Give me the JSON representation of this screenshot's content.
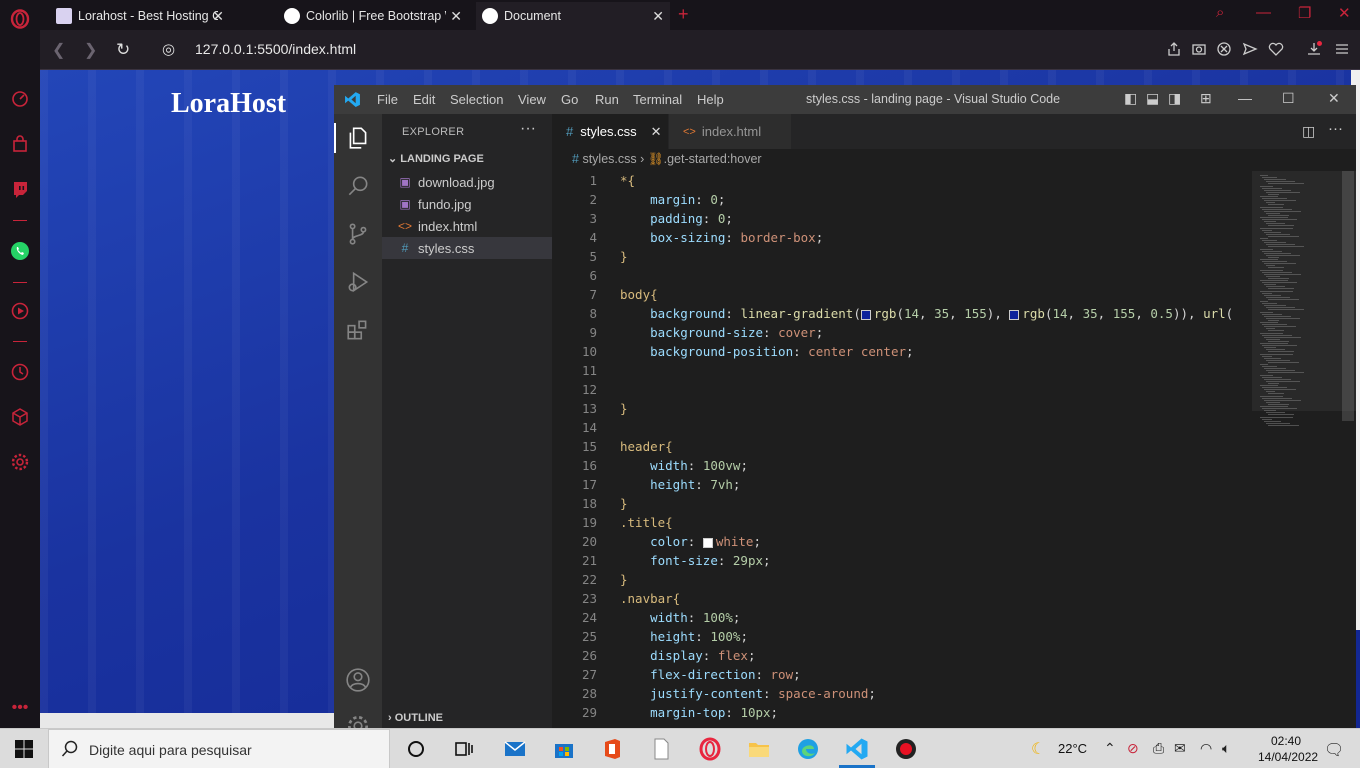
{
  "browser": {
    "tabs": [
      {
        "title": "Lorahost - Best Hosting Co",
        "active": false
      },
      {
        "title": "Colorlib | Free Bootstrap W",
        "active": false
      },
      {
        "title": "Document",
        "active": true
      }
    ],
    "url": "127.0.0.1:5500/index.html",
    "accent": "#c8243a"
  },
  "page": {
    "title": "LoraHost"
  },
  "vscode": {
    "menu": [
      "File",
      "Edit",
      "Selection",
      "View",
      "Go",
      "Run",
      "Terminal",
      "Help"
    ],
    "window_title": "styles.css - landing page - Visual Studio Code",
    "explorer": {
      "title": "EXPLORER",
      "folder": "LANDING PAGE",
      "files": [
        {
          "name": "download.jpg",
          "icon": "image-icon"
        },
        {
          "name": "fundo.jpg",
          "icon": "image-icon"
        },
        {
          "name": "index.html",
          "icon": "html-icon"
        },
        {
          "name": "styles.css",
          "icon": "css-icon",
          "selected": true
        }
      ],
      "outline": "OUTLINE"
    },
    "editor_tabs": [
      {
        "name": "styles.css",
        "active": true
      },
      {
        "name": "index.html",
        "active": false
      }
    ],
    "breadcrumb": {
      "file": "styles.css",
      "symbol": ".get-started:hover"
    },
    "code": [
      {
        "n": "1",
        "text": "*{"
      },
      {
        "n": "2",
        "text": "    margin: 0;"
      },
      {
        "n": "3",
        "text": "    padding: 0;"
      },
      {
        "n": "4",
        "text": "    box-sizing: border-box;"
      },
      {
        "n": "5",
        "text": "}"
      },
      {
        "n": "6",
        "text": ""
      },
      {
        "n": "7",
        "text": "body{"
      },
      {
        "n": "8",
        "text": "    background: linear-gradient(□rgb(14, 35, 155), □rgb(14, 35, 155, 0.5)), url("
      },
      {
        "n": "9",
        "text": "    background-size: cover;"
      },
      {
        "n": "10",
        "text": "    background-position: center center;"
      },
      {
        "n": "11",
        "text": ""
      },
      {
        "n": "12",
        "text": ""
      },
      {
        "n": "13",
        "text": "}"
      },
      {
        "n": "14",
        "text": ""
      },
      {
        "n": "15",
        "text": "header{"
      },
      {
        "n": "16",
        "text": "    width: 100vw;"
      },
      {
        "n": "17",
        "text": "    height: 7vh;"
      },
      {
        "n": "18",
        "text": "}"
      },
      {
        "n": "19",
        "text": ".title{"
      },
      {
        "n": "20",
        "text": "    color: ■white;"
      },
      {
        "n": "21",
        "text": "    font-size: 29px;"
      },
      {
        "n": "22",
        "text": "}"
      },
      {
        "n": "23",
        "text": ".navbar{"
      },
      {
        "n": "24",
        "text": "    width: 100%;"
      },
      {
        "n": "25",
        "text": "    height: 100%;"
      },
      {
        "n": "26",
        "text": "    display: flex;"
      },
      {
        "n": "27",
        "text": "    flex-direction: row;"
      },
      {
        "n": "28",
        "text": "    justify-content: space-around;"
      },
      {
        "n": "29",
        "text": "    margin-top: 10px;"
      }
    ]
  },
  "taskbar": {
    "search_placeholder": "Digite aqui para pesquisar",
    "weather": "22°C",
    "time": "02:40",
    "date": "14/04/2022"
  }
}
